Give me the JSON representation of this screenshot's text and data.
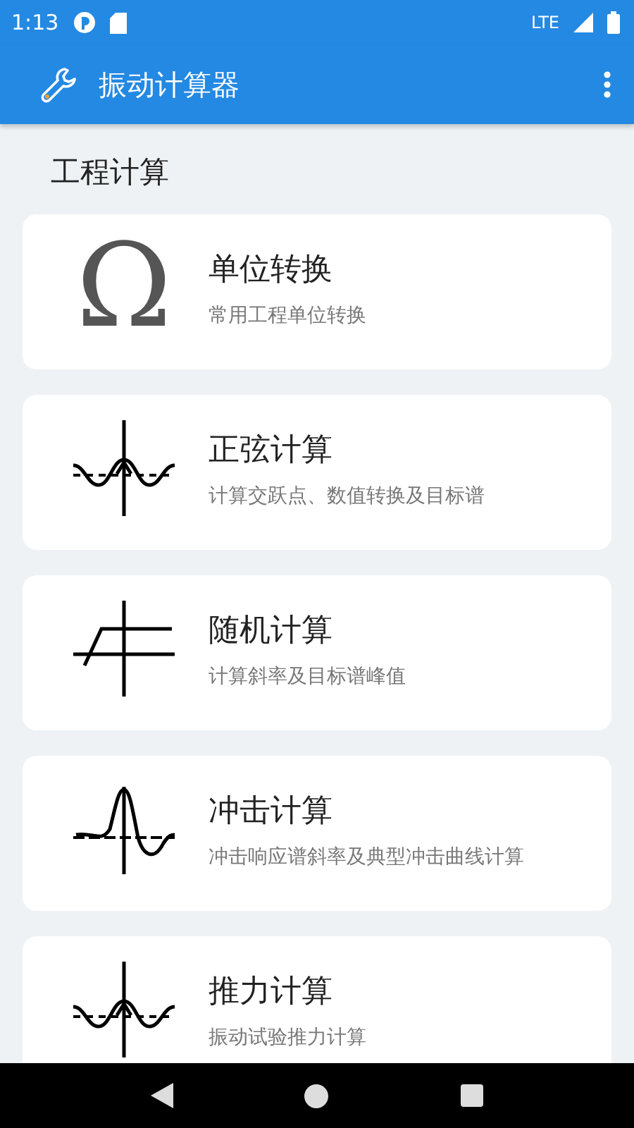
{
  "status_bar": {
    "time": "1:13",
    "network": "LTE"
  },
  "app_bar": {
    "title": "振动计算器"
  },
  "section_title": "工程计算",
  "cards": [
    {
      "kind": "omega",
      "symbol": "Ω",
      "title": "单位转换",
      "subtitle": "常用工程单位转换"
    },
    {
      "kind": "sine",
      "title": "正弦计算",
      "subtitle": "计算交跃点、数值转换及目标谱"
    },
    {
      "kind": "random",
      "title": "随机计算",
      "subtitle": "计算斜率及目标谱峰值"
    },
    {
      "kind": "shock",
      "title": "冲击计算",
      "subtitle": "冲击响应谱斜率及典型冲击曲线计算"
    },
    {
      "kind": "sine",
      "title": "推力计算",
      "subtitle": "振动试验推力计算"
    }
  ]
}
